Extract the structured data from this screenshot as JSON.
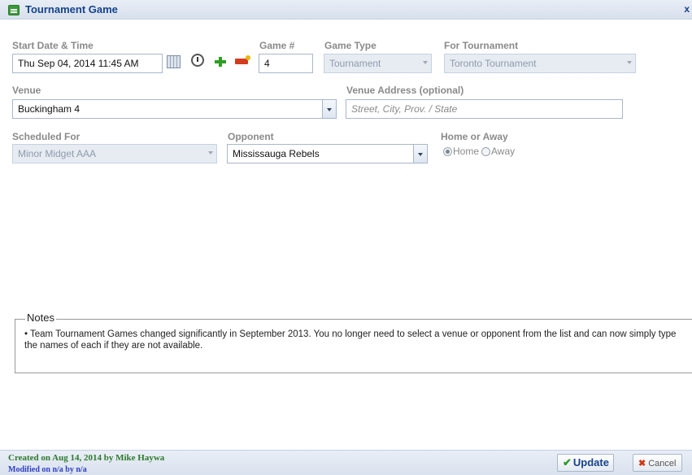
{
  "window": {
    "title": "Tournament Game",
    "close": "x"
  },
  "form": {
    "start_label": "Start Date & Time",
    "start_value": "Thu Sep 04, 2014  11:45 AM",
    "game_num_label": "Game #",
    "game_num_value": "4",
    "game_type_label": "Game Type",
    "game_type_value": "Tournament",
    "for_tournament_label": "For Tournament",
    "for_tournament_value": "Toronto Tournament",
    "venue_label": "Venue",
    "venue_value": "Buckingham 4",
    "venue_address_label": "Venue Address (optional)",
    "venue_address_placeholder": "Street, City, Prov. / State",
    "scheduled_for_label": "Scheduled For",
    "scheduled_for_value": "Minor Midget AAA",
    "opponent_label": "Opponent",
    "opponent_value": "Mississauga Rebels",
    "home_away_label": "Home or Away",
    "home_label": "Home",
    "away_label": "Away",
    "selected": "Home"
  },
  "notes": {
    "legend": "Notes",
    "text": "• Team Tournament Games changed significantly in September 2013. You no longer need to select a venue or opponent from the list and can now simply type the names of each if they are not available."
  },
  "footer": {
    "created": "Created on Aug 14, 2014 by Mike Haywa",
    "modified": "Modified on n/a by n/a",
    "update_label": "Update",
    "cancel_label": "Cancel"
  },
  "icons": [
    "calendar-icon",
    "clock-icon",
    "add-icon",
    "remove-icon",
    "check-icon",
    "cancel-x-icon"
  ]
}
